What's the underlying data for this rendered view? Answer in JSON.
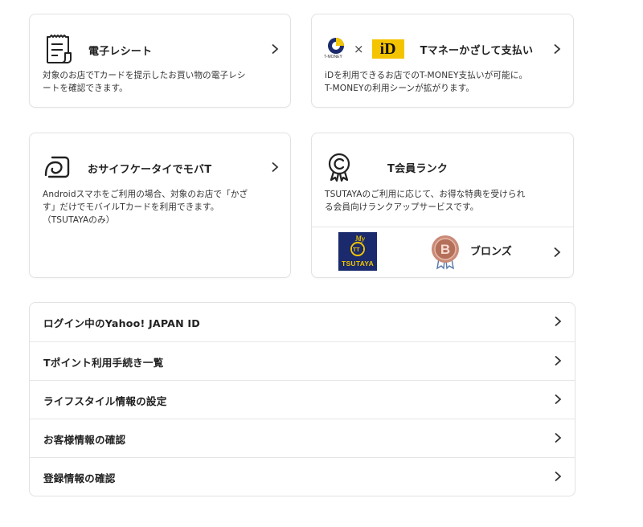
{
  "cards": {
    "receipt": {
      "icon": "receipt-icon",
      "title": "電子レシート",
      "desc_line1": "対象のお店でTカードを提示したお買い物の電子レシ",
      "desc_line2": "ートを確認できます。"
    },
    "tmoney": {
      "icon_left": "t-money-logo",
      "icon_left_label": "T-MONEY",
      "times": "×",
      "icon_right": "id-logo",
      "icon_right_label": "iD",
      "title": "Tマネーかざして支払い",
      "desc_line1": "iDを利用できるお店でのT-MONEY支払いが可能に。",
      "desc_line2": "T-MONEYの利用シーンが拡がります。"
    },
    "osaifu": {
      "icon": "osaifu-keitai-icon",
      "title": "おサイフケータイでモバT",
      "desc_line1": "Androidスマホをご利用の場合、対象のお店で「かざ",
      "desc_line2": "す」だけでモバイルTカードを利用できます。",
      "desc_line3": "（TSUTAYAのみ）"
    },
    "rank": {
      "icon": "medal-icon",
      "title": "T会員ランク",
      "desc_line1": "TSUTAYAのご利用に応じて、お得な特典を受けられ",
      "desc_line2": "る会員向けランクアップサービスです。",
      "store_logo": "tsutaya-logo",
      "store_logo_text": "TSUTAYA",
      "badge_icon": "bronze-badge-icon",
      "badge_letter": "B",
      "rank_label": "ブロンズ"
    }
  },
  "list": [
    {
      "label": "ログイン中のYahoo! JAPAN ID"
    },
    {
      "label": "Tポイント利用手続き一覧"
    },
    {
      "label": "ライフスタイル情報の設定"
    },
    {
      "label": "お客様情報の確認"
    },
    {
      "label": "登録情報の確認"
    }
  ],
  "colors": {
    "tsutaya_navy": "#1a2a6c",
    "tsutaya_yellow": "#f2c500",
    "id_yellow": "#f5c400",
    "bronze": "#c0806a",
    "border": "#e2e2e2"
  }
}
